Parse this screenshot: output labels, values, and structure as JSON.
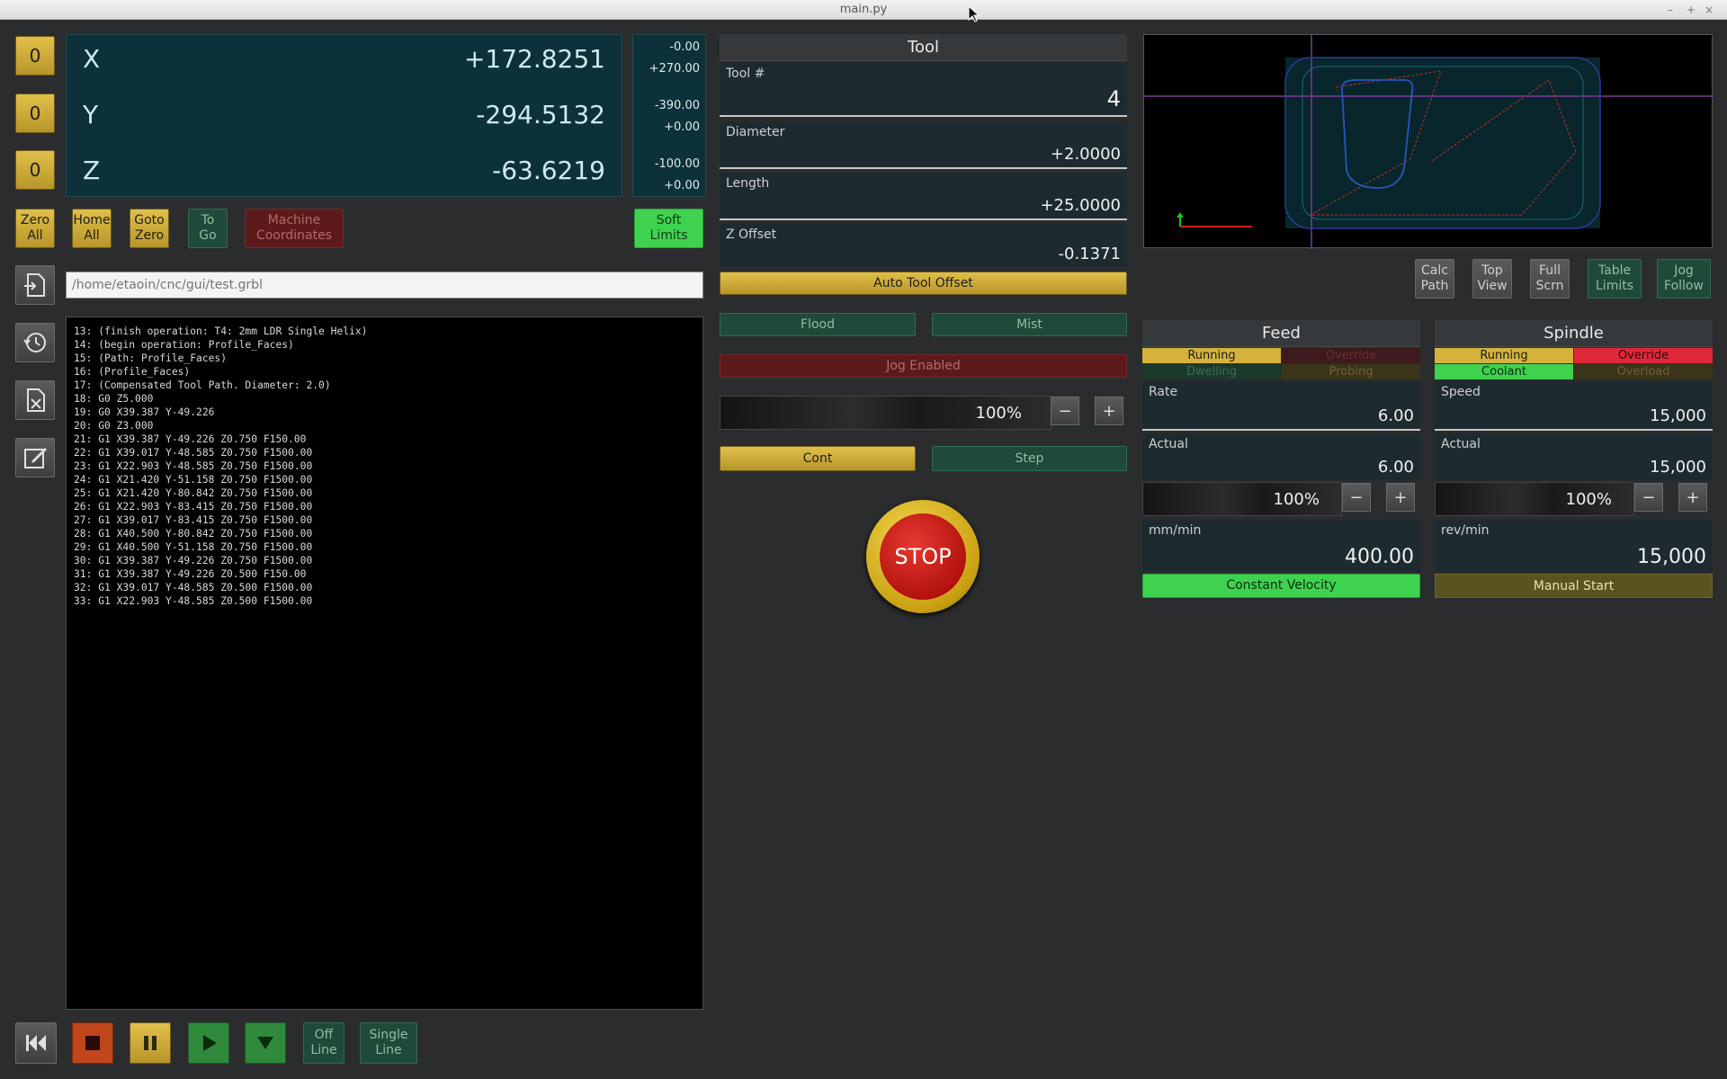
{
  "window": {
    "title": "main.py",
    "controls": [
      "–",
      "+",
      "×"
    ]
  },
  "dro": {
    "zero_label": "0",
    "axes": [
      {
        "axis": "X",
        "value": "+172.8251",
        "limit_min": "-0.00",
        "limit_max": "+270.00"
      },
      {
        "axis": "Y",
        "value": "-294.5132",
        "limit_min": "-390.00",
        "limit_max": "+0.00"
      },
      {
        "axis": "Z",
        "value": "-63.6219",
        "limit_min": "-100.00",
        "limit_max": "+0.00"
      }
    ]
  },
  "machine_buttons": {
    "zero_all": "Zero\nAll",
    "home_all": "Home\nAll",
    "goto_zero": "Goto\nZero",
    "to_go": "To\nGo",
    "machine_coordinates": "Machine\nCoordinates",
    "soft_limits": "Soft\nLimits"
  },
  "file": {
    "path_placeholder": "/home/etaoin/cnc/gui/test.grbl"
  },
  "gcode_lines": [
    "13: (finish operation: T4: 2mm LDR Single Helix)",
    "14: (begin operation: Profile_Faces)",
    "15: (Path: Profile_Faces)",
    "16: (Profile_Faces)",
    "17: (Compensated Tool Path. Diameter: 2.0)",
    "18: G0 Z5.000",
    "19: G0 X39.387 Y-49.226",
    "20: G0 Z3.000",
    "21: G1 X39.387 Y-49.226 Z0.750 F150.00",
    "22: G1 X39.017 Y-48.585 Z0.750 F1500.00",
    "23: G1 X22.903 Y-48.585 Z0.750 F1500.00",
    "24: G1 X21.420 Y-51.158 Z0.750 F1500.00",
    "25: G1 X21.420 Y-80.842 Z0.750 F1500.00",
    "26: G1 X22.903 Y-83.415 Z0.750 F1500.00",
    "27: G1 X39.017 Y-83.415 Z0.750 F1500.00",
    "28: G1 X40.500 Y-80.842 Z0.750 F1500.00",
    "29: G1 X40.500 Y-51.158 Z0.750 F1500.00",
    "30: G1 X39.387 Y-49.226 Z0.750 F1500.00",
    "31: G1 X39.387 Y-49.226 Z0.500 F150.00",
    "32: G1 X39.017 Y-48.585 Z0.500 F1500.00",
    "33: G1 X22.903 Y-48.585 Z0.500 F1500.00"
  ],
  "tool": {
    "title": "Tool",
    "tool_num_label": "Tool #",
    "tool_num": "4",
    "diameter_label": "Diameter",
    "diameter": "+2.0000",
    "length_label": "Length",
    "length": "+25.0000",
    "zoffset_label": "Z Offset",
    "zoffset": "-0.1371",
    "auto_tool_offset": "Auto Tool Offset"
  },
  "coolant": {
    "flood": "Flood",
    "mist": "Mist"
  },
  "jog": {
    "enabled_label": "Jog Enabled",
    "percent": "100%",
    "cont": "Cont",
    "step": "Step"
  },
  "stop_label": "STOP",
  "view_buttons": {
    "calc_path": "Calc\nPath",
    "top_view": "Top\nView",
    "full_scrn": "Full\nScrn",
    "table_limits": "Table\nLimits",
    "jog_follow": "Jog\nFollow"
  },
  "feed": {
    "title": "Feed",
    "running": "Running",
    "override": "Override",
    "dwelling": "Dwelling",
    "probing": "Probing",
    "rate_label": "Rate",
    "rate": "6.00",
    "actual_label": "Actual",
    "actual": "6.00",
    "percent": "100%",
    "unit_label": "mm/min",
    "unit_value": "400.00",
    "mode": "Constant Velocity"
  },
  "spindle": {
    "title": "Spindle",
    "running": "Running",
    "override": "Override",
    "coolant": "Coolant",
    "overload": "Overload",
    "speed_label": "Speed",
    "speed": "15,000",
    "actual_label": "Actual",
    "actual": "15,000",
    "percent": "100%",
    "unit_label": "rev/min",
    "unit_value": "15,000",
    "manual_start": "Manual Start"
  },
  "transport": {
    "off_line": "Off\nLine",
    "single_line": "Single\nLine"
  },
  "colors": {
    "accent_yellow": "#d4b23c",
    "dark_teal": "#0c3138",
    "green_on": "#3fd24f",
    "red_on": "#e0283a"
  }
}
